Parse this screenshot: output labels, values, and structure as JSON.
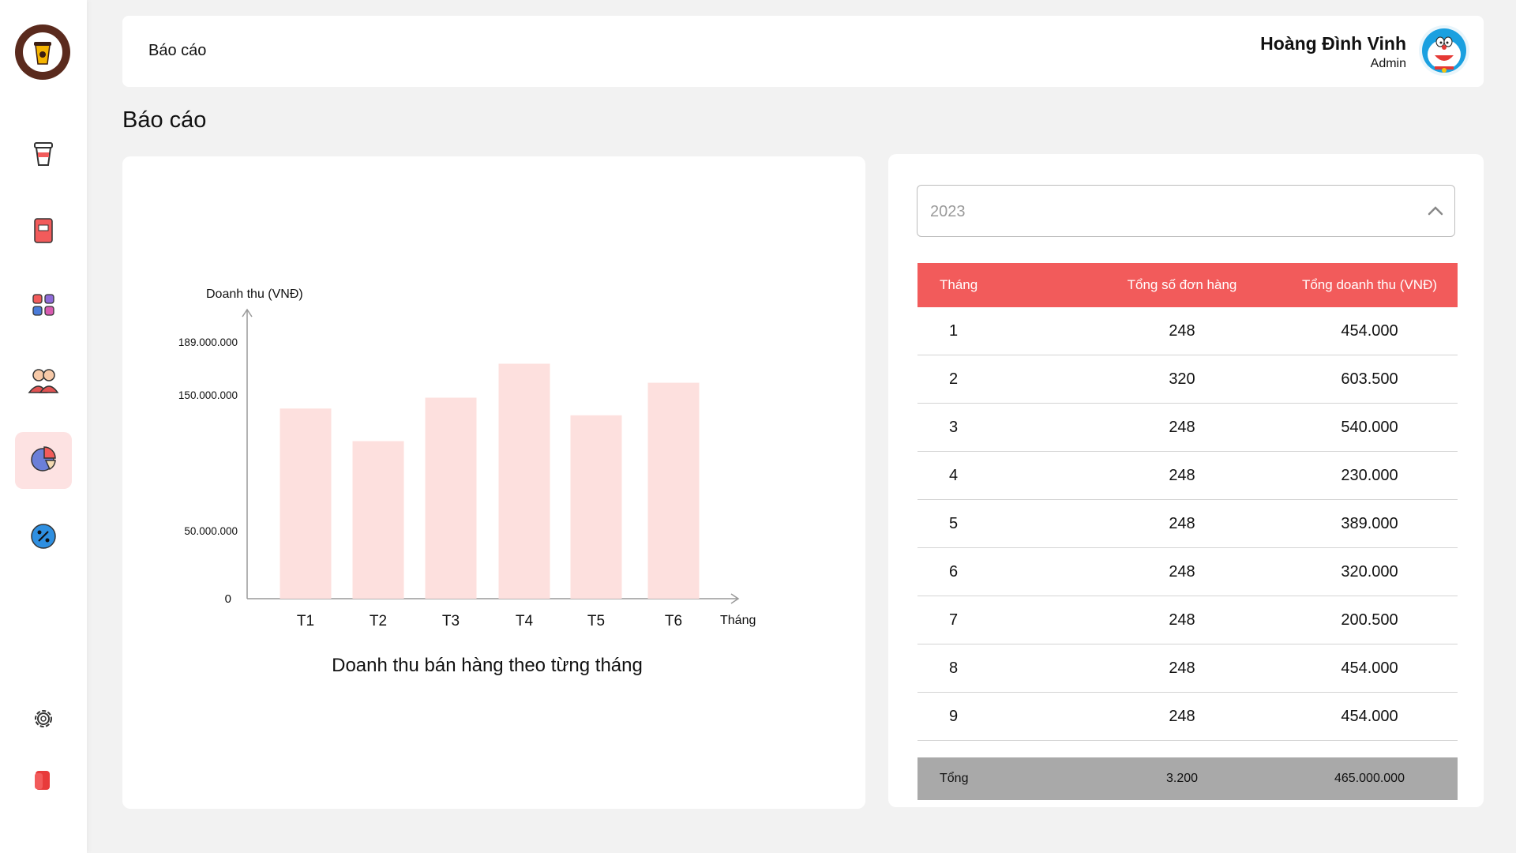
{
  "header": {
    "breadcrumb": "Báo cáo",
    "user_name": "Hoàng Đình Vinh",
    "user_role": "Admin"
  },
  "page_title": "Báo cáo",
  "sidebar": {
    "items": [
      {
        "icon": "coffee-cup-icon",
        "active": false
      },
      {
        "icon": "order-book-icon",
        "active": false
      },
      {
        "icon": "category-grid-icon",
        "active": false
      },
      {
        "icon": "staff-users-icon",
        "active": false
      },
      {
        "icon": "pie-chart-icon",
        "active": true
      },
      {
        "icon": "discount-badge-icon",
        "active": false
      },
      {
        "icon": "settings-gear-icon",
        "active": false
      },
      {
        "icon": "logout-door-icon",
        "active": false
      }
    ]
  },
  "year_select": {
    "value": "2023"
  },
  "table": {
    "headers": [
      "Tháng",
      "Tổng số đơn hàng",
      "Tổng doanh thu (VNĐ)"
    ],
    "rows": [
      [
        "1",
        "248",
        "454.000"
      ],
      [
        "2",
        "320",
        "603.500"
      ],
      [
        "3",
        "248",
        "540.000"
      ],
      [
        "4",
        "248",
        "230.000"
      ],
      [
        "5",
        "248",
        "389.000"
      ],
      [
        "6",
        "248",
        "320.000"
      ],
      [
        "7",
        "248",
        "200.500"
      ],
      [
        "8",
        "248",
        "454.000"
      ],
      [
        "9",
        "248",
        "454.000"
      ]
    ],
    "total": [
      "Tổng",
      "3.200",
      "465.000.000"
    ]
  },
  "colors": {
    "accent": "#f25b5b",
    "bar": "#fde0de",
    "active_bg": "#fde2e2",
    "total_bg": "#a9a9a9"
  },
  "chart_data": {
    "type": "bar",
    "title": "Doanh thu bán hàng theo từng tháng",
    "ylabel": "Doanh thu (VNĐ)",
    "xlabel": "Tháng",
    "categories": [
      "T1",
      "T2",
      "T3",
      "T4",
      "T5",
      "T6"
    ],
    "values": [
      140000000,
      116000000,
      148000000,
      173000000,
      135000000,
      159000000
    ],
    "yticks": [
      {
        "value": 0,
        "label": "0"
      },
      {
        "value": 50000000,
        "label": "50.000.000"
      },
      {
        "value": 150000000,
        "label": "150.000.000"
      },
      {
        "value": 189000000,
        "label": "189.000.000"
      }
    ],
    "ylim": [
      0,
      189000000
    ],
    "grid": false
  }
}
